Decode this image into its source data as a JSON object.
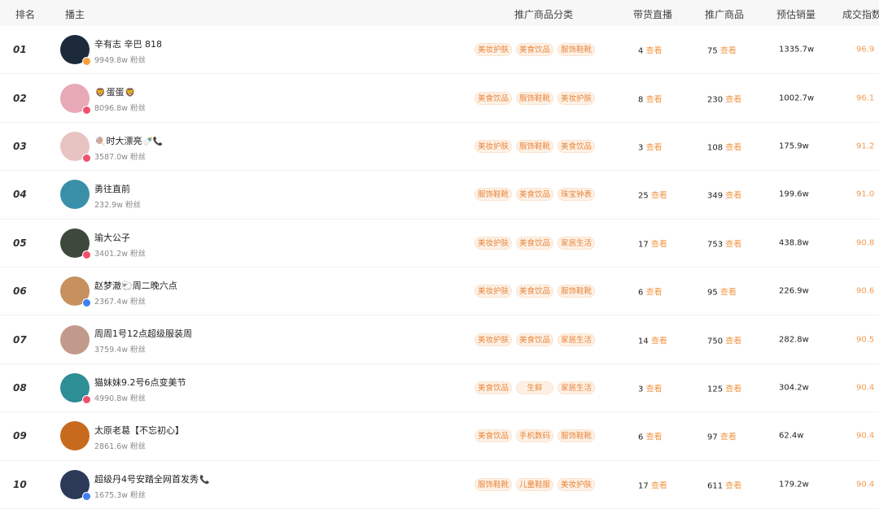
{
  "header": {
    "rank": "排名",
    "host": "播主",
    "category": "推广商品分类",
    "live": "带货直播",
    "goods": "推广商品",
    "sales": "预估销量",
    "index": "成交指数"
  },
  "look_label": "查看",
  "rows": [
    {
      "rank": "01",
      "name": "辛有志 辛巴 818",
      "fans": "9949.8w 粉丝",
      "tags": [
        "美妆护肤",
        "美食饮品",
        "服饰鞋靴"
      ],
      "live": "4",
      "goods": "75",
      "sales": "1335.7w",
      "index": "96.9"
    },
    {
      "rank": "02",
      "name_prefix": "🦁",
      "name": "蛋蛋",
      "name_suffix": "🦁",
      "fans": "8096.8w 粉丝",
      "tags": [
        "美食饮品",
        "服饰鞋靴",
        "美妆护肤"
      ],
      "live": "8",
      "goods": "230",
      "sales": "1002.7w",
      "index": "96.1"
    },
    {
      "rank": "03",
      "name_prefix": "🍭",
      "name": "时大漂亮",
      "name_suffix": "🍼📞",
      "fans": "3587.0w 粉丝",
      "tags": [
        "美妆护肤",
        "服饰鞋靴",
        "美食饮品"
      ],
      "live": "3",
      "goods": "108",
      "sales": "175.9w",
      "index": "91.2"
    },
    {
      "rank": "04",
      "name": "勇往直前",
      "fans": "232.9w 粉丝",
      "tags": [
        "服饰鞋靴",
        "美食饮品",
        "珠宝钟表"
      ],
      "live": "25",
      "goods": "349",
      "sales": "199.6w",
      "index": "91.0"
    },
    {
      "rank": "05",
      "name": "瑜大公子",
      "fans": "3401.2w 粉丝",
      "tags": [
        "美妆护肤",
        "美食饮品",
        "家居生活"
      ],
      "live": "17",
      "goods": "753",
      "sales": "438.8w",
      "index": "90.8"
    },
    {
      "rank": "06",
      "name": "赵梦澈🐑周二晚六点",
      "fans": "2367.4w 粉丝",
      "tags": [
        "美妆护肤",
        "美食饮品",
        "服饰鞋靴"
      ],
      "live": "6",
      "goods": "95",
      "sales": "226.9w",
      "index": "90.6"
    },
    {
      "rank": "07",
      "name": "周周1号12点超级服装周",
      "fans": "3759.4w 粉丝",
      "tags": [
        "美妆护肤",
        "美食饮品",
        "家居生活"
      ],
      "live": "14",
      "goods": "750",
      "sales": "282.8w",
      "index": "90.5"
    },
    {
      "rank": "08",
      "name": "猫妹妹9.2号6点变美节",
      "fans": "4990.8w 粉丝",
      "tags": [
        "美食饮品",
        "生鲜",
        "家居生活"
      ],
      "live": "3",
      "goods": "125",
      "sales": "304.2w",
      "index": "90.4"
    },
    {
      "rank": "09",
      "name": "太原老葛【不忘初心】",
      "fans": "2861.6w 粉丝",
      "tags": [
        "美食饮品",
        "手机数码",
        "服饰鞋靴"
      ],
      "live": "6",
      "goods": "97",
      "sales": "62.4w",
      "index": "90.4"
    },
    {
      "rank": "10",
      "name": "超级丹4号安踏全网首发秀",
      "name_suffix": "📞",
      "fans": "1675.3w 粉丝",
      "tags": [
        "服饰鞋靴",
        "儿童鞋服",
        "美妆护肤"
      ],
      "live": "17",
      "goods": "611",
      "sales": "179.2w",
      "index": "90.4"
    }
  ],
  "avatars": [
    {
      "color": "#1c2a3c",
      "badge": "orange"
    },
    {
      "color": "#e8a9b6",
      "badge": "red"
    },
    {
      "color": "#e7c4c1",
      "badge": "red"
    },
    {
      "color": "#3a8fa8",
      "badge": "none"
    },
    {
      "color": "#3d4a3b",
      "badge": "red"
    },
    {
      "color": "#c6915e",
      "badge": "blue"
    },
    {
      "color": "#c29a8c",
      "badge": "none"
    },
    {
      "color": "#2d8e95",
      "badge": "red"
    },
    {
      "color": "#c76a1d",
      "badge": "none"
    },
    {
      "color": "#2c3a58",
      "badge": "blue"
    }
  ]
}
